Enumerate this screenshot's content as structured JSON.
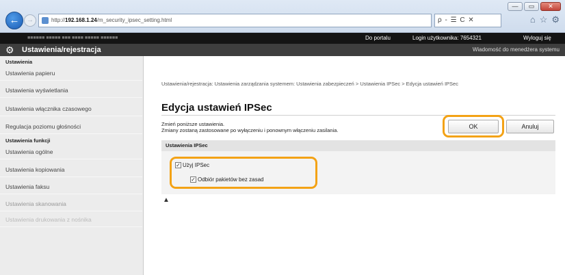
{
  "browser": {
    "url_prefix": "http://",
    "url_host": "192.168.1.24",
    "url_path": "/m_security_ipsec_setting.html",
    "search_text": "ρ - ☰ C ✕",
    "window_controls": [
      "—",
      "▭",
      "✕"
    ],
    "toolbar_icons": [
      "home-icon",
      "star-icon",
      "gear-icon"
    ]
  },
  "topbar": {
    "model": "■■■■■■ ■■■■■ ■■■ ■■■■ ■■■■■ ■■■■■■",
    "portal_link": "Do portalu",
    "login_label": "Login użytkownika:  7654321",
    "logout_link": "Wyloguj się"
  },
  "header": {
    "title": "Ustawienia/rejestracja",
    "admin_message": "Wiadomość do menedżera systemu"
  },
  "sidebar": {
    "group1": "Ustawienia",
    "items1": [
      "Ustawienia papieru",
      "Ustawienia wyświetlania",
      "Ustawienia włącznika czasowego",
      "Regulacja poziomu głośności"
    ],
    "group2": "Ustawienia funkcji",
    "items2": [
      "Ustawienia ogólne",
      "Ustawienia kopiowania",
      "Ustawienia faksu",
      "Ustawienia skanowania",
      "Ustawienia drukowania z nośnika"
    ]
  },
  "main": {
    "breadcrumb": "Ustawienia/rejestracja: Ustawienia zarządzania systemem: Ustawienia zabezpieczeń > Ustawienia IPSec > Edycja ustawień IPSec",
    "page_title": "Edycja ustawień IPSec",
    "instruction1": "Zmień poniższe ustawienia.",
    "instruction2": "Zmiany zostaną zastosowane po wyłączeniu i ponownym włączeniu zasilania.",
    "ok_label": "OK",
    "cancel_label": "Anuluj",
    "section_title": "Ustawienia IPSec",
    "use_ipsec_label": "Użyj IPSec",
    "receive_label": "Odbiór pakietów bez zasad",
    "use_ipsec_checked": true,
    "receive_checked": true,
    "top_link": "▲"
  },
  "colors": {
    "highlight": "#f3a215",
    "topbar": "#141414",
    "titlebar": "#3e3e3e"
  }
}
